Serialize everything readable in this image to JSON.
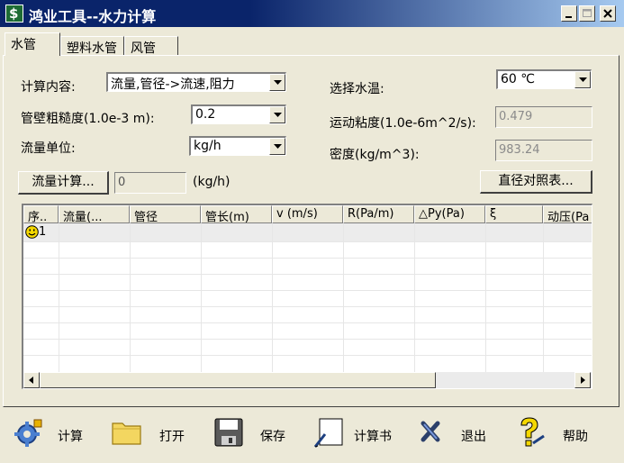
{
  "window": {
    "title": "鸿业工具--水力计算"
  },
  "tabs": [
    {
      "label": "水管"
    },
    {
      "label": "塑料水管"
    },
    {
      "label": "风管"
    }
  ],
  "form": {
    "calc_content_label": "计算内容:",
    "calc_content_value": "流量,管径->流速,阻力",
    "roughness_label": "管壁粗糙度(1.0e-3 m):",
    "roughness_value": "0.2",
    "flow_unit_label": "流量单位:",
    "flow_unit_value": "kg/h",
    "water_temp_label": "选择水温:",
    "water_temp_value": "60  ℃",
    "viscosity_label": "运动粘度(1.0e-6m^2/s):",
    "viscosity_value": "0.479",
    "density_label": "密度(kg/m^3):",
    "density_value": "983.24",
    "flow_calc_button": "流量计算...",
    "flow_value": "0",
    "flow_unit_suffix": "(kg/h)",
    "diameter_table_button": "直径对照表..."
  },
  "grid": {
    "columns": [
      "序..",
      "流量(...",
      "管径",
      "管长(m)",
      "v (m/s)",
      "R(Pa/m)",
      "△Py(Pa)",
      "ξ",
      "动压(Pa"
    ],
    "rows": [
      {
        "index": "1"
      }
    ]
  },
  "toolbar": {
    "calc": "计算",
    "open": "打开",
    "save": "保存",
    "report": "计算书",
    "exit": "退出",
    "help": "帮助"
  },
  "colors": {
    "titlebar": "#0a246a",
    "face": "#ece9d8",
    "accent_yellow": "#f5d800"
  }
}
